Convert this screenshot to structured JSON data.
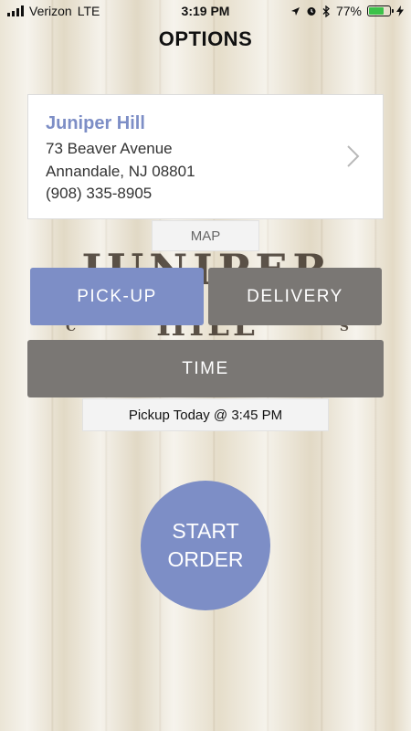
{
  "status_bar": {
    "carrier": "Verizon",
    "network": "LTE",
    "time": "3:19 PM",
    "battery": "77%",
    "battery_level": 0.77,
    "icons": [
      "signal-icon",
      "location-arrow-icon",
      "alarm-icon",
      "bluetooth-icon",
      "battery-icon",
      "charging-icon"
    ]
  },
  "page": {
    "title": "OPTIONS"
  },
  "store": {
    "name": "Juniper Hill",
    "address_line1": "73 Beaver Avenue",
    "address_line2": "Annandale, NJ 08801",
    "phone": "(908) 335-8905"
  },
  "map_label": "MAP",
  "logo": {
    "line1": "JUNIPER",
    "line2": "HILL",
    "left_letter": "C",
    "right_letter": "S"
  },
  "order_type": {
    "pickup_label": "PICK-UP",
    "delivery_label": "DELIVERY",
    "selected": "pickup"
  },
  "time_label": "TIME",
  "pickup_info": "Pickup Today @ 3:45 PM",
  "start_order": {
    "line1": "START",
    "line2": "ORDER"
  },
  "colors": {
    "accent": "#7d8ec6",
    "inactive_button": "#7a7774",
    "battery_green": "#3cc24a"
  }
}
